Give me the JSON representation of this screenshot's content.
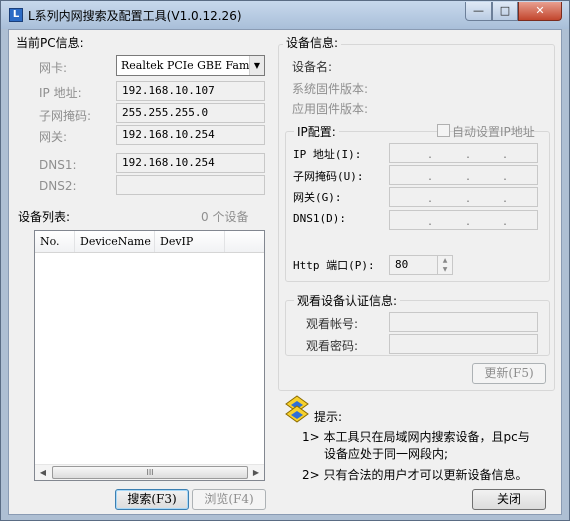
{
  "window": {
    "title": "L系列内网搜索及配置工具(V1.0.12.26)",
    "controls": {
      "minimize": "—",
      "maximize": "□",
      "close": "✕"
    }
  },
  "pc_info": {
    "group_title": "当前PC信息:",
    "nic_label": "网卡:",
    "nic_value": "Realtek PCIe GBE Fami",
    "ip_label": "IP 地址:",
    "ip_value": "192.168.10.107",
    "mask_label": "子网掩码:",
    "mask_value": "255.255.255.0",
    "gateway_label": "网关:",
    "gateway_value": "192.168.10.254",
    "dns1_label": "DNS1:",
    "dns1_value": "192.168.10.254",
    "dns2_label": "DNS2:",
    "dns2_value": ""
  },
  "device_list": {
    "title": "设备列表:",
    "count_text": "0 个设备",
    "columns": [
      "No.",
      "DeviceName",
      "DevIP"
    ],
    "scroll_grip": "III"
  },
  "device_info": {
    "group_title": "设备信息:",
    "name_label": "设备名:",
    "sys_fw_label": "系统固件版本:",
    "app_fw_label": "应用固件版本:"
  },
  "ip_config": {
    "group_title": "IP配置:",
    "auto_ip_label": "自动设置IP地址",
    "ip_label": "IP 地址(I):",
    "mask_label": "子网掩码(U):",
    "gateway_label": "网关(G):",
    "dns1_label": "DNS1(D):",
    "http_port_label": "Http 端口(P):",
    "http_port_value": "80",
    "ip_dot": "."
  },
  "auth": {
    "group_title": "观看设备认证信息:",
    "account_label": "观看帐号:",
    "password_label": "观看密码:"
  },
  "buttons": {
    "update": "更新(F5)",
    "search": "搜索(F3)",
    "browse": "浏览(F4)",
    "close": "关闭"
  },
  "tips": {
    "title": "提示:",
    "line1": "1> 本工具只在局域网内搜索设备，且pc与",
    "line1b": "设备应处于同一网段内;",
    "line2": "2> 只有合法的用户才可以更新设备信息。"
  }
}
